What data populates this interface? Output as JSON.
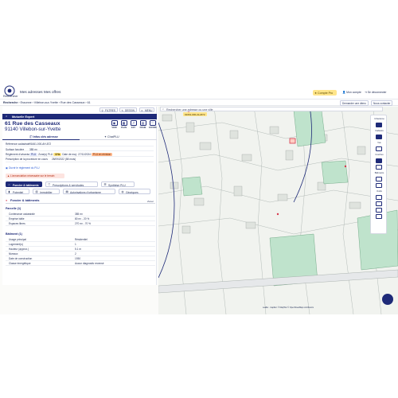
{
  "topbar": {
    "nav": [
      "Rechercher",
      "Mes adresses",
      "Mes offres"
    ],
    "pro_button": "Compte Pro",
    "account": "Mon compte",
    "logout": "Se déconnecter",
    "demo": "Demander une démo",
    "contact": "Nous contacter"
  },
  "breadcrumb": {
    "label": "Recherche",
    "path": "› Essonne › Villebon-sur-Yvette › Rue des Casseaux › 61"
  },
  "panel": {
    "mini_tabs": [
      "FILTRES",
      "DESSIN",
      "MENU"
    ],
    "header": "Mutuelle Expert",
    "address_line1": "61 Rue des Casseaux",
    "address_line2": "91140 Villebon-sur-Yvette",
    "actions": [
      "VOIR",
      "PLAN",
      "EXT",
      "FICHE",
      "FAVORI"
    ],
    "tabs": [
      "Infos clés adresse",
      "ChatPLU"
    ],
    "info_rows": [
      {
        "k": "Référence cadastrale",
        "v": "91661-000-AH-872"
      },
      {
        "k": "Surface foncière",
        "v": "385 m²"
      },
      {
        "k": "Règlement d'urbanisme",
        "v": "PLU",
        "zone": "Zone(s) PLU",
        "zone_val": "UHa",
        "date": "Date de maj : 27/11/2024",
        "risk": "PLU en révision"
      },
      {
        "k": "Prescription de la procédure en cours",
        "v": "28/09/2022 (58 mois)"
      }
    ],
    "link_text": "Ouvrir le règlement du PLU",
    "alert_text": "L'annonciation nécessaire sur le terrain"
  },
  "chips": [
    {
      "label": "Foncier & bâtiments",
      "active": true
    },
    {
      "label": "Prescriptions & servitudes",
      "active": false
    },
    {
      "label": "Synthèse PLU",
      "active": false
    },
    {
      "label": "Potentiel",
      "active": false
    },
    {
      "label": "Immobilier",
      "active": false
    },
    {
      "label": "Autorisations d'urbanisme",
      "active": false
    },
    {
      "label": "Géoriques",
      "active": false
    }
  ],
  "section": {
    "title": "Foncier & bâtiments",
    "right": "Zoner",
    "parcel_title": "Parcelle (1)",
    "parcel_rows": [
      {
        "k": "Contenance cadastrale",
        "v": "385 m²"
      },
      {
        "k": "Emprise bâtie",
        "v": "80 m² - 20 %"
      },
      {
        "k": "Espaces libres",
        "v": "270 m² - 70 %"
      }
    ],
    "building_title": "Bâtiment (1)",
    "building_rows": [
      {
        "k": "Usage principal",
        "v": "Résidentiel"
      },
      {
        "k": "Logement(s)",
        "v": "1"
      },
      {
        "k": "Hauteur (approx.)",
        "v": "5.1 m"
      },
      {
        "k": "Niveaux",
        "v": "2"
      },
      {
        "k": "Date de construction",
        "v": "1930"
      },
      {
        "k": "Classe énergétique",
        "v": "Aucun diagnostic recensé"
      }
    ]
  },
  "map": {
    "search_placeholder": "Rechercher une adresse ou une ville",
    "tooltip": "91661-000-AH-872",
    "controls": [
      "Urbanisme",
      "Cadastre",
      "Vue",
      "Couches",
      "Bâtiments",
      "Outils"
    ],
    "attribution": "Leaflet · maptiler: © MapTiler © OpenStreetMap contributors"
  },
  "colors": {
    "accent": "#1e2a78",
    "pro": "#ffe58a",
    "alert": "#d6394d",
    "map_green": "#bfe3cc"
  }
}
